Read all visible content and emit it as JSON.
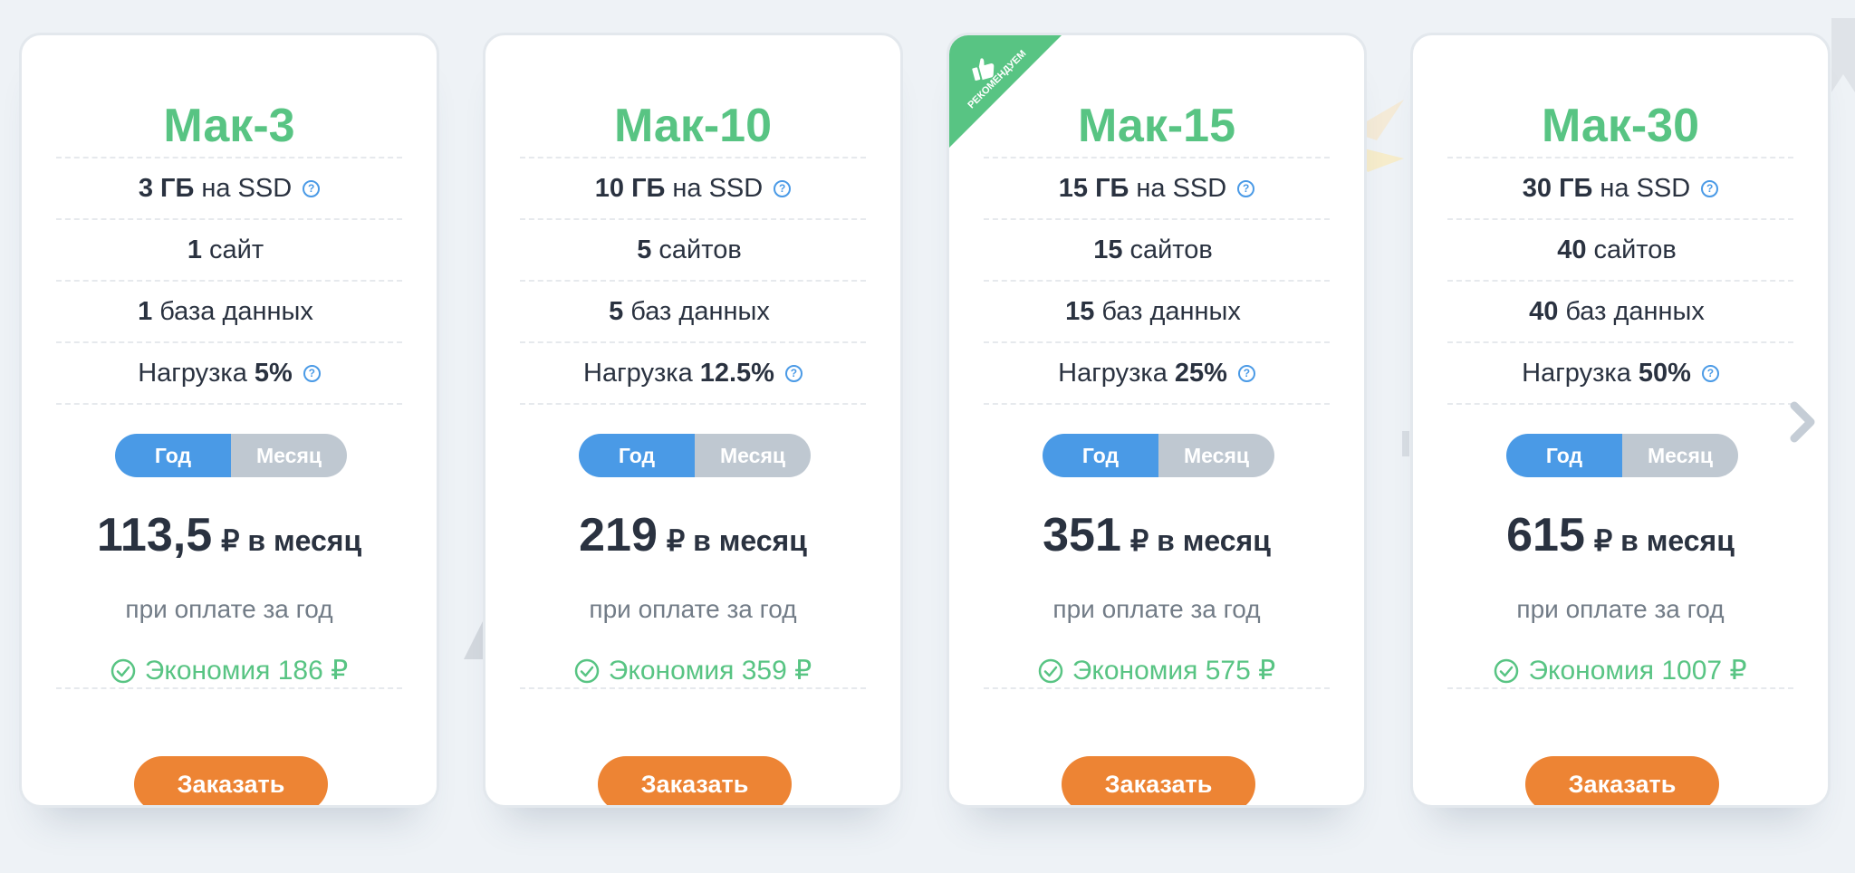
{
  "plans": [
    {
      "name": "Мак-3",
      "recommended": false,
      "features": [
        {
          "strong": "3 ГБ",
          "after": "на SSD",
          "help": true
        },
        {
          "strong": "1",
          "after": "сайт",
          "help": false
        },
        {
          "strong": "1",
          "after": "база данных",
          "help": false
        },
        {
          "before": "Нагрузка",
          "strong": "5%",
          "help": true
        }
      ],
      "toggle": {
        "year": "Год",
        "month": "Месяц"
      },
      "price": "113,5",
      "price_unit": "₽ в месяц",
      "price_note": "при оплате за год",
      "savings": "Экономия 186 ₽",
      "order_label": "Заказать"
    },
    {
      "name": "Мак-10",
      "recommended": false,
      "features": [
        {
          "strong": "10 ГБ",
          "after": "на SSD",
          "help": true
        },
        {
          "strong": "5",
          "after": "сайтов",
          "help": false
        },
        {
          "strong": "5",
          "after": "баз данных",
          "help": false
        },
        {
          "before": "Нагрузка",
          "strong": "12.5%",
          "help": true
        }
      ],
      "toggle": {
        "year": "Год",
        "month": "Месяц"
      },
      "price": "219",
      "price_unit": "₽ в месяц",
      "price_note": "при оплате за год",
      "savings": "Экономия 359 ₽",
      "order_label": "Заказать"
    },
    {
      "name": "Мак-15",
      "recommended": true,
      "ribbon_label": "РЕКОМЕНДУЕМ",
      "features": [
        {
          "strong": "15 ГБ",
          "after": "на SSD",
          "help": true
        },
        {
          "strong": "15",
          "after": "сайтов",
          "help": false
        },
        {
          "strong": "15",
          "after": "баз данных",
          "help": false
        },
        {
          "before": "Нагрузка",
          "strong": "25%",
          "help": true
        }
      ],
      "toggle": {
        "year": "Год",
        "month": "Месяц"
      },
      "price": "351",
      "price_unit": "₽ в месяц",
      "price_note": "при оплате за год",
      "savings": "Экономия 575 ₽",
      "order_label": "Заказать"
    },
    {
      "name": "Мак-30",
      "recommended": false,
      "features": [
        {
          "strong": "30 ГБ",
          "after": "на SSD",
          "help": true
        },
        {
          "strong": "40",
          "after": "сайтов",
          "help": false
        },
        {
          "strong": "40",
          "after": "баз данных",
          "help": false
        },
        {
          "before": "Нагрузка",
          "strong": "50%",
          "help": true
        }
      ],
      "toggle": {
        "year": "Год",
        "month": "Месяц"
      },
      "price": "615",
      "price_unit": "₽ в месяц",
      "price_note": "при оплате за год",
      "savings": "Экономия 1007 ₽",
      "order_label": "Заказать"
    }
  ],
  "colors": {
    "background": "#eef2f6",
    "title_green": "#58c483",
    "ribbon_green": "#58c483",
    "toggle_active": "#4a9ae6",
    "toggle_inactive": "#bfc8d1",
    "order_orange": "#ed8434",
    "text_dark": "#2a3240",
    "text_muted": "#727c87"
  },
  "icons": {
    "help": "question-circle",
    "savings": "check-circle",
    "ribbon": "thumbs-up",
    "carousel_next": "chevron-right"
  }
}
